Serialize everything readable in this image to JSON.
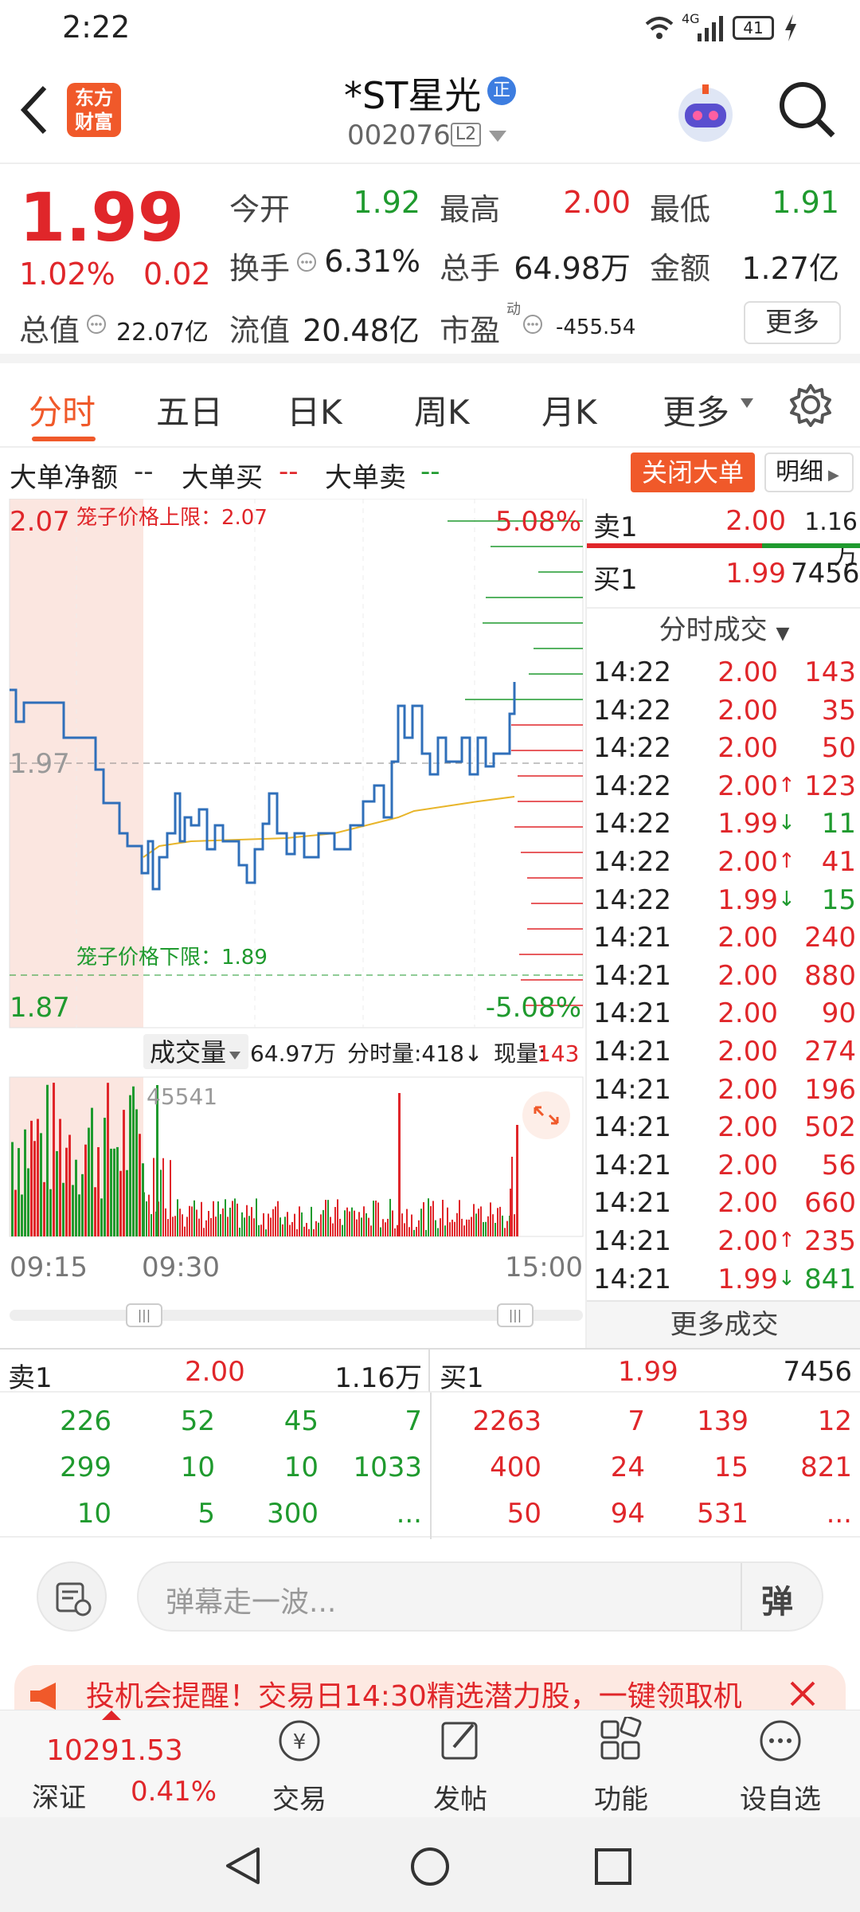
{
  "status_bar": {
    "time": "2:22",
    "network": "4G",
    "battery": "41"
  },
  "header": {
    "logo_line1": "东方",
    "logo_line2": "财富",
    "title": "*ST星光",
    "title_badge": "正",
    "code": "002076",
    "level": "L2"
  },
  "quote": {
    "price": "1.99",
    "change_pct": "1.02%",
    "change": "0.02",
    "open_label": "今开",
    "open": "1.92",
    "high_label": "最高",
    "high": "2.00",
    "low_label": "最低",
    "low": "1.91",
    "turnover_label": "换手",
    "turnover": "6.31%",
    "volume_label": "总手",
    "volume": "64.98万",
    "amount_label": "金额",
    "amount": "1.27亿",
    "mktcap_label": "总值",
    "mktcap": "22.07亿",
    "float_label": "流值",
    "float_cap": "20.48亿",
    "pe_label": "市盈",
    "pe_sup": "动",
    "pe": "-455.54",
    "more": "更多"
  },
  "tabs": [
    "分时",
    "五日",
    "日K",
    "周K",
    "月K",
    "更多"
  ],
  "big_order": {
    "net_label": "大单净额",
    "net": "--",
    "buy_label": "大单买",
    "buy": "--",
    "sell_label": "大单卖",
    "sell": "--",
    "close_btn": "关闭大单",
    "detail_btn": "明细"
  },
  "chart": {
    "upper_price": "2.07",
    "upper_pct": "5.08%",
    "upper_limit_label": "笼子价格上限：2.07",
    "prev_close": "1.97",
    "lower_price": "1.87",
    "lower_pct": "-5.08%",
    "lower_limit_label": "笼子价格下限：1.89",
    "vol_label": "成交量",
    "vol_total": "64.97万",
    "vol_time": "分时量:418↓",
    "vol_now_label": "现量:",
    "vol_now": "143",
    "vol_max": "45541",
    "t_start": "09:15",
    "t_open": "09:30",
    "t_end": "15:00",
    "colors": {
      "price_line": "#2f6fba",
      "avg_line": "#e8b52a",
      "up": "#e0262a",
      "down": "#1f9a2e"
    }
  },
  "order_top": {
    "sell1_label": "卖1",
    "sell1_price": "2.00",
    "sell1_vol": "1.16万",
    "buy1_label": "买1",
    "buy1_price": "1.99",
    "buy1_vol": "7456"
  },
  "ticks_header": "分时成交",
  "ticks": [
    {
      "time": "14:22",
      "price": "2.00",
      "vol": "143",
      "dir": "",
      "pc": "red",
      "vc": "red"
    },
    {
      "time": "14:22",
      "price": "2.00",
      "vol": "35",
      "dir": "",
      "pc": "red",
      "vc": "red"
    },
    {
      "time": "14:22",
      "price": "2.00",
      "vol": "50",
      "dir": "",
      "pc": "red",
      "vc": "red"
    },
    {
      "time": "14:22",
      "price": "2.00",
      "vol": "123",
      "dir": "↑",
      "pc": "red",
      "vc": "red"
    },
    {
      "time": "14:22",
      "price": "1.99",
      "vol": "11",
      "dir": "↓",
      "pc": "red",
      "vc": "green"
    },
    {
      "time": "14:22",
      "price": "2.00",
      "vol": "41",
      "dir": "↑",
      "pc": "red",
      "vc": "red"
    },
    {
      "time": "14:22",
      "price": "1.99",
      "vol": "15",
      "dir": "↓",
      "pc": "red",
      "vc": "green"
    },
    {
      "time": "14:21",
      "price": "2.00",
      "vol": "240",
      "dir": "",
      "pc": "red",
      "vc": "red"
    },
    {
      "time": "14:21",
      "price": "2.00",
      "vol": "880",
      "dir": "",
      "pc": "red",
      "vc": "red"
    },
    {
      "time": "14:21",
      "price": "2.00",
      "vol": "90",
      "dir": "",
      "pc": "red",
      "vc": "red"
    },
    {
      "time": "14:21",
      "price": "2.00",
      "vol": "274",
      "dir": "",
      "pc": "red",
      "vc": "red"
    },
    {
      "time": "14:21",
      "price": "2.00",
      "vol": "196",
      "dir": "",
      "pc": "red",
      "vc": "red"
    },
    {
      "time": "14:21",
      "price": "2.00",
      "vol": "502",
      "dir": "",
      "pc": "red",
      "vc": "red"
    },
    {
      "time": "14:21",
      "price": "2.00",
      "vol": "56",
      "dir": "",
      "pc": "red",
      "vc": "red"
    },
    {
      "time": "14:21",
      "price": "2.00",
      "vol": "660",
      "dir": "",
      "pc": "red",
      "vc": "red"
    },
    {
      "time": "14:21",
      "price": "2.00",
      "vol": "235",
      "dir": "↑",
      "pc": "red",
      "vc": "red"
    },
    {
      "time": "14:21",
      "price": "1.99",
      "vol": "841",
      "dir": "↓",
      "pc": "red",
      "vc": "green"
    }
  ],
  "more_ticks": "更多成交",
  "book": {
    "sell_label": "卖1",
    "sell_price": "2.00",
    "sell_vol": "1.16万",
    "buy_label": "买1",
    "buy_price": "1.99",
    "buy_vol": "7456",
    "sell_rows": [
      [
        "226",
        "52",
        "45",
        "7"
      ],
      [
        "299",
        "10",
        "10",
        "1033"
      ],
      [
        "10",
        "5",
        "300",
        "..."
      ]
    ],
    "buy_rows": [
      [
        "2263",
        "7",
        "139",
        "12"
      ],
      [
        "400",
        "24",
        "15",
        "821"
      ],
      [
        "50",
        "94",
        "531",
        "..."
      ]
    ]
  },
  "danmu": {
    "placeholder": "弹幕走一波...",
    "btn": "弹"
  },
  "promo": {
    "text": "投机会提醒！交易日14:30精选潜力股，一键领取机"
  },
  "bottom_nav": {
    "index_value": "10291.53",
    "index_name": "深证",
    "index_pct": "0.41%",
    "items": [
      "交易",
      "发帖",
      "功能",
      "设自选"
    ]
  }
}
